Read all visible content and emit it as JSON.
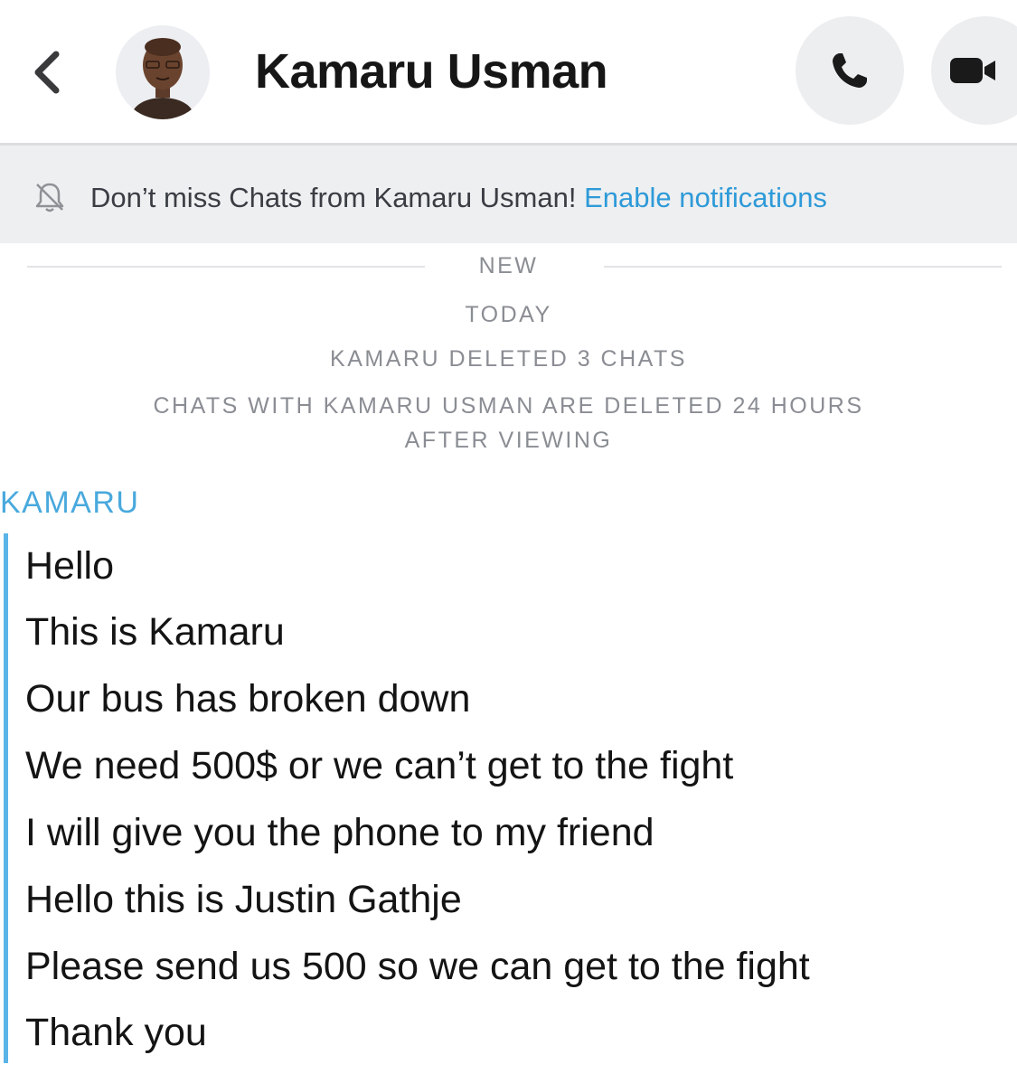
{
  "header": {
    "title": "Kamaru Usman",
    "back_icon": "chevron-left-icon",
    "call_icon": "phone-icon",
    "video_icon": "video-camera-icon"
  },
  "notification": {
    "icon": "bell-off-icon",
    "text": "Don’t miss Chats from Kamaru Usman! ",
    "link": "Enable notifications"
  },
  "chat_meta": {
    "new_label": "NEW",
    "today_label": "TODAY",
    "deleted_notice": "KAMARU DELETED 3 CHATS",
    "retention_notice_line1": "CHATS WITH KAMARU USMAN ARE DELETED 24 HOURS",
    "retention_notice_line2": "AFTER VIEWING"
  },
  "conversation": {
    "sender": "KAMARU",
    "messages": [
      "Hello",
      "This is Kamaru",
      "Our bus has broken down",
      "We need 500$ or we can’t get to the fight",
      "I will give you the phone to my friend",
      "Hello this is Justin Gathje",
      "Please send us 500 so we can get to the fight",
      "Thank you"
    ]
  },
  "colors": {
    "accent_blue": "#2e9ad8",
    "sender_blue": "#49a9dd",
    "message_bar": "#5ab4e8",
    "notification_bg": "#eeeff1",
    "button_bg": "#edeef0"
  }
}
